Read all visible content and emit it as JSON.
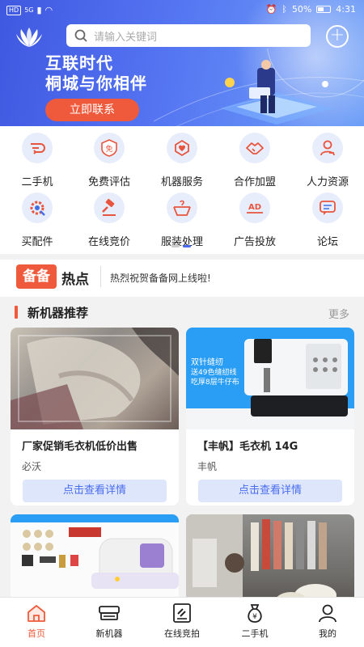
{
  "status_bar": {
    "left": [
      "HD",
      "5G"
    ],
    "battery": "50%",
    "time": "4:31"
  },
  "search": {
    "placeholder": "请输入关键词"
  },
  "banner": {
    "headline_line1": "互联时代",
    "headline_line2": "桐城与你相伴",
    "button": "立即联系"
  },
  "categories": [
    {
      "label": "二手机",
      "icon": "secondhand-icon"
    },
    {
      "label": "免费评估",
      "icon": "free-evaluate-icon"
    },
    {
      "label": "机器服务",
      "icon": "machine-service-icon"
    },
    {
      "label": "合作加盟",
      "icon": "handshake-icon"
    },
    {
      "label": "人力资源",
      "icon": "person-icon"
    },
    {
      "label": "买配件",
      "icon": "gear-icon"
    },
    {
      "label": "在线竞价",
      "icon": "gavel-icon"
    },
    {
      "label": "服装处理",
      "icon": "clothing-box-icon"
    },
    {
      "label": "广告投放",
      "icon": "ad-icon"
    },
    {
      "label": "论坛",
      "icon": "forum-icon"
    }
  ],
  "news": {
    "badge": "备备",
    "label": "热点",
    "message": "热烈祝贺备备网上线啦!"
  },
  "section": {
    "title": "新机器推荐",
    "more": "更多"
  },
  "products": [
    {
      "title": "厂家促销毛衣机低价出售",
      "brand": "必沃",
      "button": "点击查看详情"
    },
    {
      "title": "【丰帆】毛衣机 14G",
      "brand": "丰帆",
      "button": "点击查看详情",
      "image_text_1": "双针缝纫",
      "image_text_2": "送49色缝纫线",
      "image_text_3": "吃厚8层牛仔布"
    },
    {
      "title": "",
      "brand": ""
    },
    {
      "title": "",
      "brand": ""
    }
  ],
  "bottom_nav": [
    {
      "label": "首页",
      "active": true
    },
    {
      "label": "新机器",
      "active": false
    },
    {
      "label": "在线竞拍",
      "active": false
    },
    {
      "label": "二手机",
      "active": false
    },
    {
      "label": "我的",
      "active": false
    }
  ],
  "colors": {
    "primary": "#4a6cf0",
    "accent": "#ef5a3c"
  }
}
